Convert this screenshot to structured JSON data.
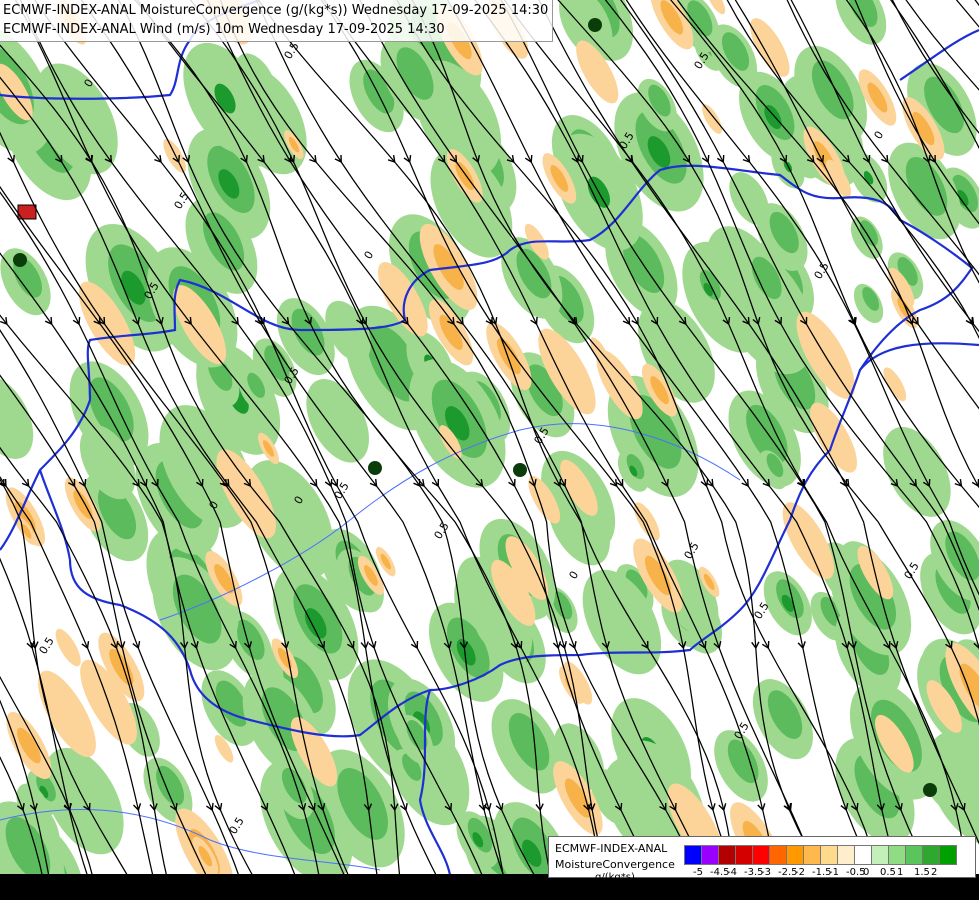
{
  "header": {
    "line1": "ECMWF-INDEX-ANAL MoistureConvergence (g/(kg*s)) Wednesday 17-09-2025 14:30",
    "line2": "ECMWF-INDEX-ANAL Wind (m/s) 10m Wednesday 17-09-2025 14:30"
  },
  "colors": {
    "background": "#ffffff",
    "green_light": "#9fd98f",
    "green_mid": "#5cbb5c",
    "green_dark": "#1c9a2e",
    "orange_light": "#fcd49a",
    "orange_mid": "#f7b24a",
    "border": "#1f2fd6",
    "streamline": "#000000"
  },
  "map_labels": [
    "0",
    "0.5",
    "0.5",
    "0",
    "0.5",
    "0",
    "0.5",
    "0.5",
    "0",
    "0.5",
    "0.5",
    "0.5",
    "0.5",
    "0",
    "0.5",
    "0.5",
    "0.5",
    "0",
    "0.5",
    "0.5",
    "0.5",
    "0.5"
  ],
  "legend": {
    "name_line1": "ECMWF-INDEX-ANAL",
    "name_line2": "MoistureConvergence",
    "units": "g/(kg*s)",
    "colors": [
      "#0000ff",
      "#9900ff",
      "#b30000",
      "#d40000",
      "#ff0000",
      "#ff6600",
      "#ff9900",
      "#ffb84d",
      "#ffd98c",
      "#ffeecc",
      "#ffffff",
      "#c2f0b8",
      "#8fdc84",
      "#5cc45c",
      "#2ea82e",
      "#00a000"
    ],
    "ticks": [
      "-5",
      "-4.5",
      "-4",
      "-3.5",
      "-3",
      "-2.5",
      "-2",
      "-1.5",
      "-1",
      "-0.5",
      "0",
      "0.5",
      "1",
      "1.5",
      "2"
    ]
  }
}
